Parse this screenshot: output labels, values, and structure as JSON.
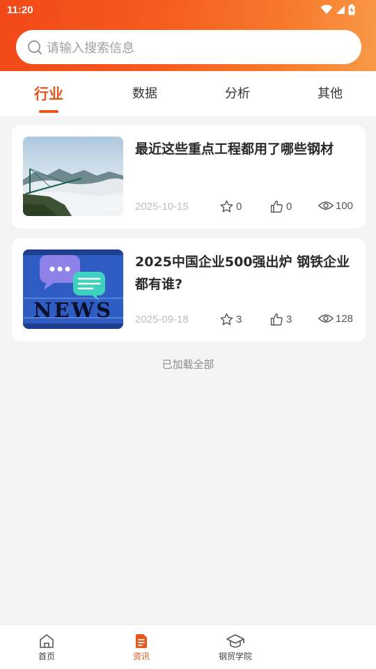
{
  "status_bar": {
    "time": "11:20"
  },
  "search": {
    "placeholder": "请输入搜索信息"
  },
  "tabs": [
    {
      "label": "行业",
      "active": true
    },
    {
      "label": "数据",
      "active": false
    },
    {
      "label": "分析",
      "active": false
    },
    {
      "label": "其他",
      "active": false
    }
  ],
  "articles": [
    {
      "title": "最近这些重点工程都用了哪些钢材",
      "date": "2025-10-15",
      "favorites": "0",
      "likes": "0",
      "views": "100",
      "thumbnail": "bridge-over-clouds"
    },
    {
      "title": "2025中国企业500强出炉 钢铁企业都有谁?",
      "date": "2025-09-18",
      "favorites": "3",
      "likes": "3",
      "views": "128",
      "thumbnail": "news-chat-bubbles",
      "thumbnail_text": "NEWS"
    }
  ],
  "list_footer": "已加载全部",
  "bottom_nav": [
    {
      "label": "首页",
      "icon": "home-icon",
      "active": false
    },
    {
      "label": "资讯",
      "icon": "document-icon",
      "active": true
    },
    {
      "label": "钢贸学院",
      "icon": "graduation-cap-icon",
      "active": false
    }
  ],
  "colors": {
    "accent": "#e8561c",
    "header_gradient_start": "#f24818",
    "header_gradient_end": "#f89a48",
    "background": "#f4f4f4"
  }
}
